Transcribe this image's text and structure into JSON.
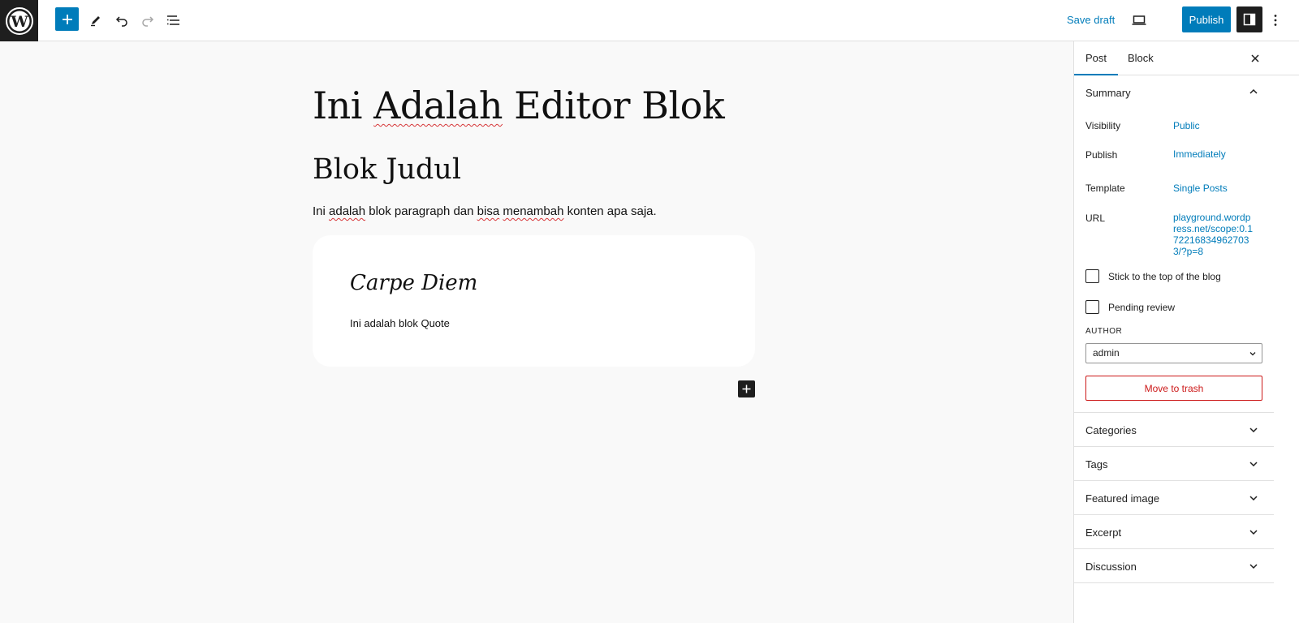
{
  "toolbar": {
    "save_draft": "Save draft",
    "publish": "Publish"
  },
  "editor": {
    "title_word1": "Ini",
    "title_spell": "Adalah",
    "title_rest": "Editor Blok",
    "heading": "Blok Judul",
    "para_part1": "Ini ",
    "para_spell1": "adalah",
    "para_part2": " blok paragraph dan ",
    "para_spell2": "bisa",
    "para_part3": " ",
    "para_spell3": "menambah",
    "para_part4": " konten apa saja.",
    "quote_text": "Carpe Diem",
    "quote_cite": "Ini adalah blok Quote"
  },
  "sidebar": {
    "tabs": [
      "Post",
      "Block"
    ],
    "summary_title": "Summary",
    "rows": [
      {
        "label": "Visibility",
        "value": "Public"
      },
      {
        "label": "Publish",
        "value": "Immediately"
      },
      {
        "label": "Template",
        "value": "Single Posts"
      },
      {
        "label": "URL",
        "value": "playground.wordpress.net/scope:0.172216834962703 3/?p=8"
      }
    ],
    "url_lines": [
      "playground.wordp",
      "ress.net/scope:0.1",
      "72216834962703",
      "3/?p=8"
    ],
    "stick_label": "Stick to the top of the blog",
    "pending_label": "Pending review",
    "author_label": "AUTHOR",
    "author_value": "admin",
    "trash_label": "Move to trash",
    "panels": [
      "Categories",
      "Tags",
      "Featured image",
      "Excerpt",
      "Discussion"
    ]
  },
  "colors": {
    "accent": "#007cba",
    "danger": "#cc1818",
    "dark": "#1e1e1e"
  }
}
